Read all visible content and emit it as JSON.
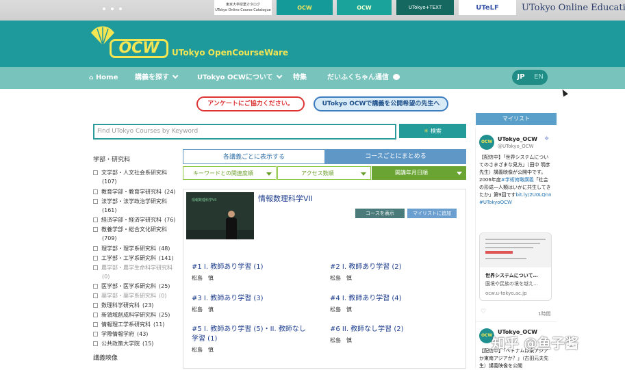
{
  "banners": {
    "catalog_title": "東京大学授業カタログ",
    "catalog_sub": "UTokyo Online Course Catalogue",
    "ocw_a": "OCW",
    "ocw_b": "OCW",
    "text": "UTokyo+TEXT",
    "utelf": "UTeLF",
    "online_education": "UTokyo Online Educati"
  },
  "header": {
    "logo": "OCW",
    "subtitle": "UTokyo OpenCourseWare"
  },
  "nav": {
    "home": "Home",
    "find_courses": "講義を探す",
    "about": "UTokyo OCWについて",
    "features": "特集",
    "newsletter": "だいふくちゃん通信",
    "lang_jp": "JP",
    "lang_en": "EN"
  },
  "notices": {
    "survey": "アンケートにご協力ください。",
    "faculty": "UTokyo OCWで講義を公開希望の先生へ"
  },
  "search": {
    "placeholder": "Find UTokyo Courses by Keyword",
    "button": "検索"
  },
  "sidebar": {
    "faculty_heading": "学部・研究科",
    "facets": [
      {
        "label": "文学部・人文社会系研究科",
        "count": "(107)",
        "dim": false
      },
      {
        "label": "教育学部・教育学研究科",
        "count": "(24)",
        "dim": false
      },
      {
        "label": "法学部・法学政治学研究科",
        "count": "(161)",
        "dim": false
      },
      {
        "label": "経済学部・経済学研究科",
        "count": "(76)",
        "dim": false
      },
      {
        "label": "教養学部・総合文化研究科",
        "count": "(709)",
        "dim": false
      },
      {
        "label": "理学部・理学系研究科",
        "count": "(48)",
        "dim": false
      },
      {
        "label": "工学部・工学系研究科",
        "count": "(141)",
        "dim": false
      },
      {
        "label": "農学部・農学生命科学研究科",
        "count": "(0)",
        "dim": true
      },
      {
        "label": "医学部・医学系研究科",
        "count": "(25)",
        "dim": false
      },
      {
        "label": "薬学部・薬学系研究科",
        "count": "(0)",
        "dim": true
      },
      {
        "label": "数理科学研究科",
        "count": "(23)",
        "dim": false
      },
      {
        "label": "新領域創成科学研究科",
        "count": "(25)",
        "dim": false
      },
      {
        "label": "情報理工学系研究科",
        "count": "(11)",
        "dim": false
      },
      {
        "label": "学際情報学府",
        "count": "(43)",
        "dim": false
      },
      {
        "label": "公共政策大学院",
        "count": "(15)",
        "dim": false
      }
    ],
    "video_heading": "講義映像"
  },
  "view_tabs": {
    "by_lecture": "各講義ごとに表示する",
    "by_course": "コースごとにまとめる"
  },
  "sort": {
    "relevance": "キーワードとの関連度順",
    "access": "アクセス数順",
    "date": "開講年月日順"
  },
  "course": {
    "title": "情報数理科学VII",
    "show_button": "コースを表示",
    "add_button": "マイリストに追加",
    "thumb_chalk": "情報数理科学VII",
    "lectures": [
      {
        "title": "#1 I. 教師あり学習 (1)",
        "author": "松島　慎"
      },
      {
        "title": "#2 I. 教師あり学習 (2)",
        "author": "松島　慎"
      },
      {
        "title": "#3 I. 教師あり学習 (3)",
        "author": "松島　慎"
      },
      {
        "title": "#4 I. 教師あり学習 (4)",
        "author": "松島　慎"
      },
      {
        "title": "#5 I. 教師あり学習 (5)・II. 教師なし学習 (1)",
        "author": "松島　慎"
      },
      {
        "title": "#6 II. 教師なし学習 (2)",
        "author": "松島　慎"
      }
    ]
  },
  "mylist": {
    "heading": "マイリスト"
  },
  "tweets": [
    {
      "name": "UTokyo_OCW",
      "handle": "@UTokyo_OCW",
      "text": "【配信中】「世界システムについてのさまざまな見方」（田中 明彦先生）講義映像が公開中です。2006年度",
      "hashtag1": "#学術俯瞰講義",
      "text2": "「社会の形成―人類はいかに共生してきたか」第9回です",
      "link": "bit.ly/2U0LQnn",
      "hashtag2": "#UTokyoOCW",
      "card_title": "世界システムについて…",
      "card_desc": "国境や民族の境を越え…",
      "card_url": "ocw.u-tokyo.ac.jp",
      "time": "1時間"
    },
    {
      "name": "UTokyo_OCW",
      "text": "【配信中】「ベトナムは東アジアか東南アジアか？」（古田元夫先生）講義映像を公開"
    }
  ],
  "watermark": "知乎 @鱼子酱"
}
